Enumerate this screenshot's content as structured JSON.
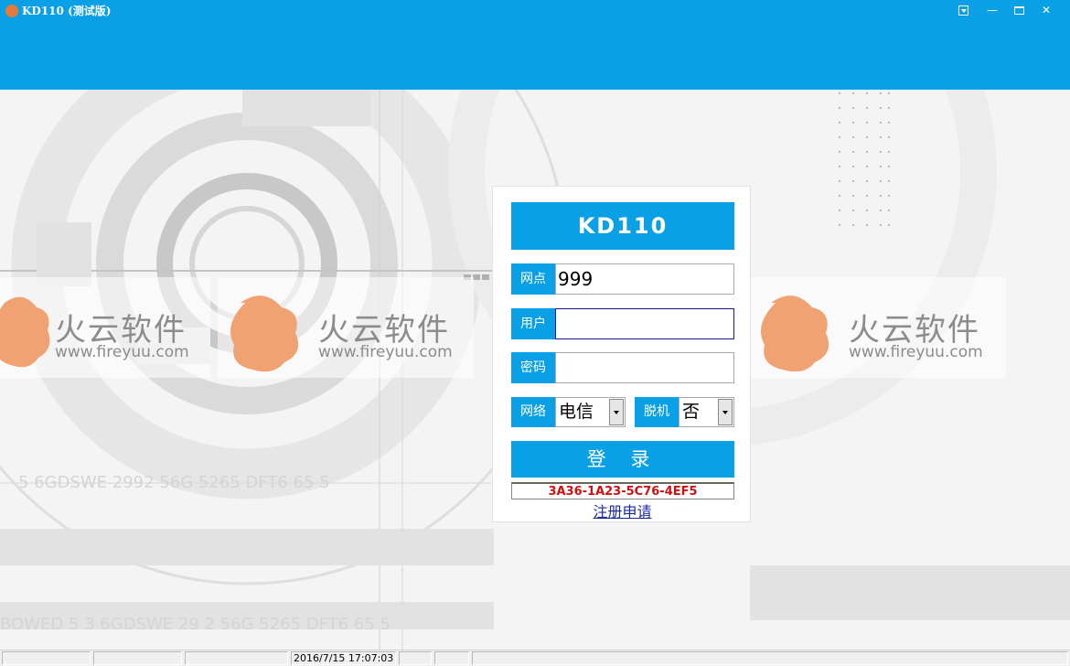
{
  "window": {
    "title": "KD110 (测试版)"
  },
  "watermark": {
    "brand": "火云软件",
    "url": "www.fireyuu.com"
  },
  "login": {
    "logo_text": "KD110",
    "site": {
      "label": "网点",
      "value": "999"
    },
    "user": {
      "label": "用户",
      "value": ""
    },
    "password": {
      "label": "密码",
      "value": ""
    },
    "network": {
      "label": "网络",
      "value": "电信"
    },
    "offline": {
      "label": "脱机",
      "value": "否"
    },
    "login_button": "登 录",
    "machine_code": "3A36-1A23-5C76-4EF5",
    "register_link": "注册申请"
  },
  "statusbar": {
    "datetime": "2016/7/15 17:07:03"
  },
  "colors": {
    "accent": "#0aa0e6",
    "code_text": "#d01010",
    "link": "#1a2aa0"
  }
}
